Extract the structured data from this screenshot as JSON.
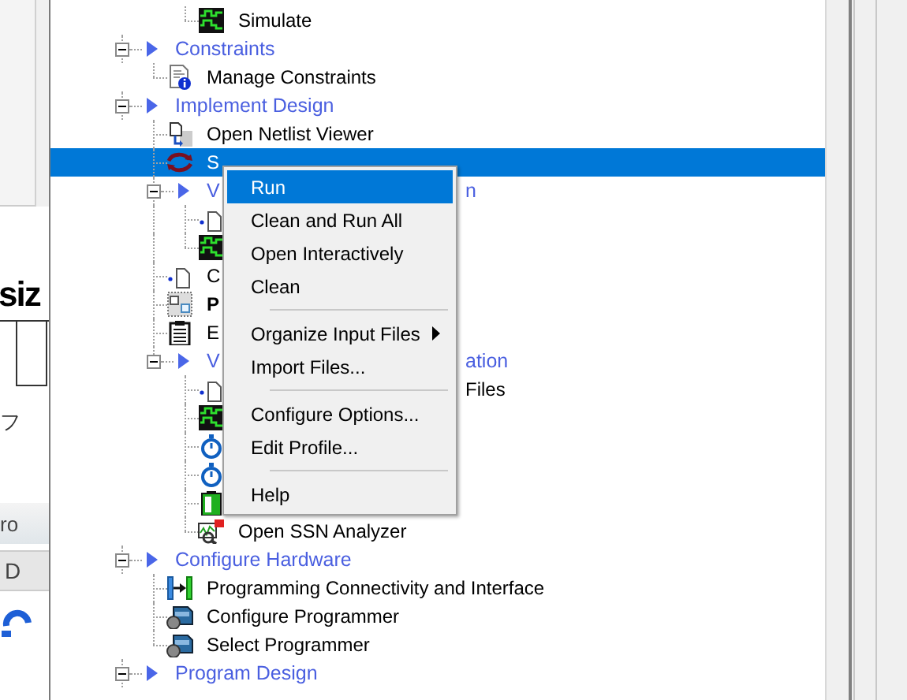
{
  "background_window": {
    "heading": "siz",
    "text_1": "フ",
    "text_2": "ro",
    "tab": "D"
  },
  "tree": [
    {
      "children": [
        {
          "children": [
            {
              "label": "Simulate",
              "kind": "simulation"
            }
          ]
        }
      ]
    },
    {
      "label": "Constraints",
      "kind": "group",
      "expanded": true,
      "children": [
        {
          "label": "Manage Constraints",
          "kind": "constraints"
        }
      ]
    },
    {
      "label": "Implement Design",
      "kind": "group",
      "expanded": true,
      "children": [
        {
          "label": "Open Netlist Viewer",
          "kind": "viewer"
        },
        {
          "label": "S",
          "kind": "synthesis",
          "selected": true
        },
        {
          "label": "V",
          "tail": "n",
          "kind": "group",
          "expanded": true,
          "children": [
            {
              "kind": "file"
            },
            {
              "kind": "simulation"
            }
          ]
        },
        {
          "label": "C",
          "kind": "file"
        },
        {
          "label": "P",
          "kind": "placer",
          "bold": true
        },
        {
          "label": "E",
          "kind": "report"
        },
        {
          "label": "V",
          "tail": "ation",
          "kind": "group",
          "expanded": true,
          "children": [
            {
              "tail": "Files",
              "kind": "file"
            },
            {
              "kind": "simulation"
            },
            {
              "kind": "timing"
            },
            {
              "kind": "timing"
            },
            {
              "kind": "power"
            },
            {
              "label": "Open SSN Analyzer",
              "kind": "analyzer"
            }
          ]
        }
      ]
    },
    {
      "label": "Configure Hardware",
      "kind": "group",
      "expanded": true,
      "children": [
        {
          "label": "Programming Connectivity and Interface",
          "kind": "connectivity"
        },
        {
          "label": "Configure Programmer",
          "kind": "programmer"
        },
        {
          "label": "Select Programmer",
          "kind": "programmer"
        }
      ]
    },
    {
      "label": "Program Design",
      "kind": "group",
      "expanded": true
    }
  ],
  "context_menu": [
    {
      "kind": "item",
      "label": "Run",
      "selected": true
    },
    {
      "kind": "item",
      "label": "Clean and Run All",
      "selected": false
    },
    {
      "kind": "item",
      "label": "Open Interactively",
      "selected": false
    },
    {
      "kind": "item",
      "label": "Clean",
      "selected": false
    },
    {
      "kind": "separator"
    },
    {
      "kind": "item",
      "label": "Organize Input Files",
      "selected": false,
      "submenu": true
    },
    {
      "kind": "item",
      "label": "Import Files...",
      "selected": false
    },
    {
      "kind": "separator"
    },
    {
      "kind": "item",
      "label": "Configure Options...",
      "selected": false
    },
    {
      "kind": "item",
      "label": "Edit Profile...",
      "selected": false
    },
    {
      "kind": "separator"
    },
    {
      "kind": "item",
      "label": "Help",
      "selected": false
    }
  ]
}
